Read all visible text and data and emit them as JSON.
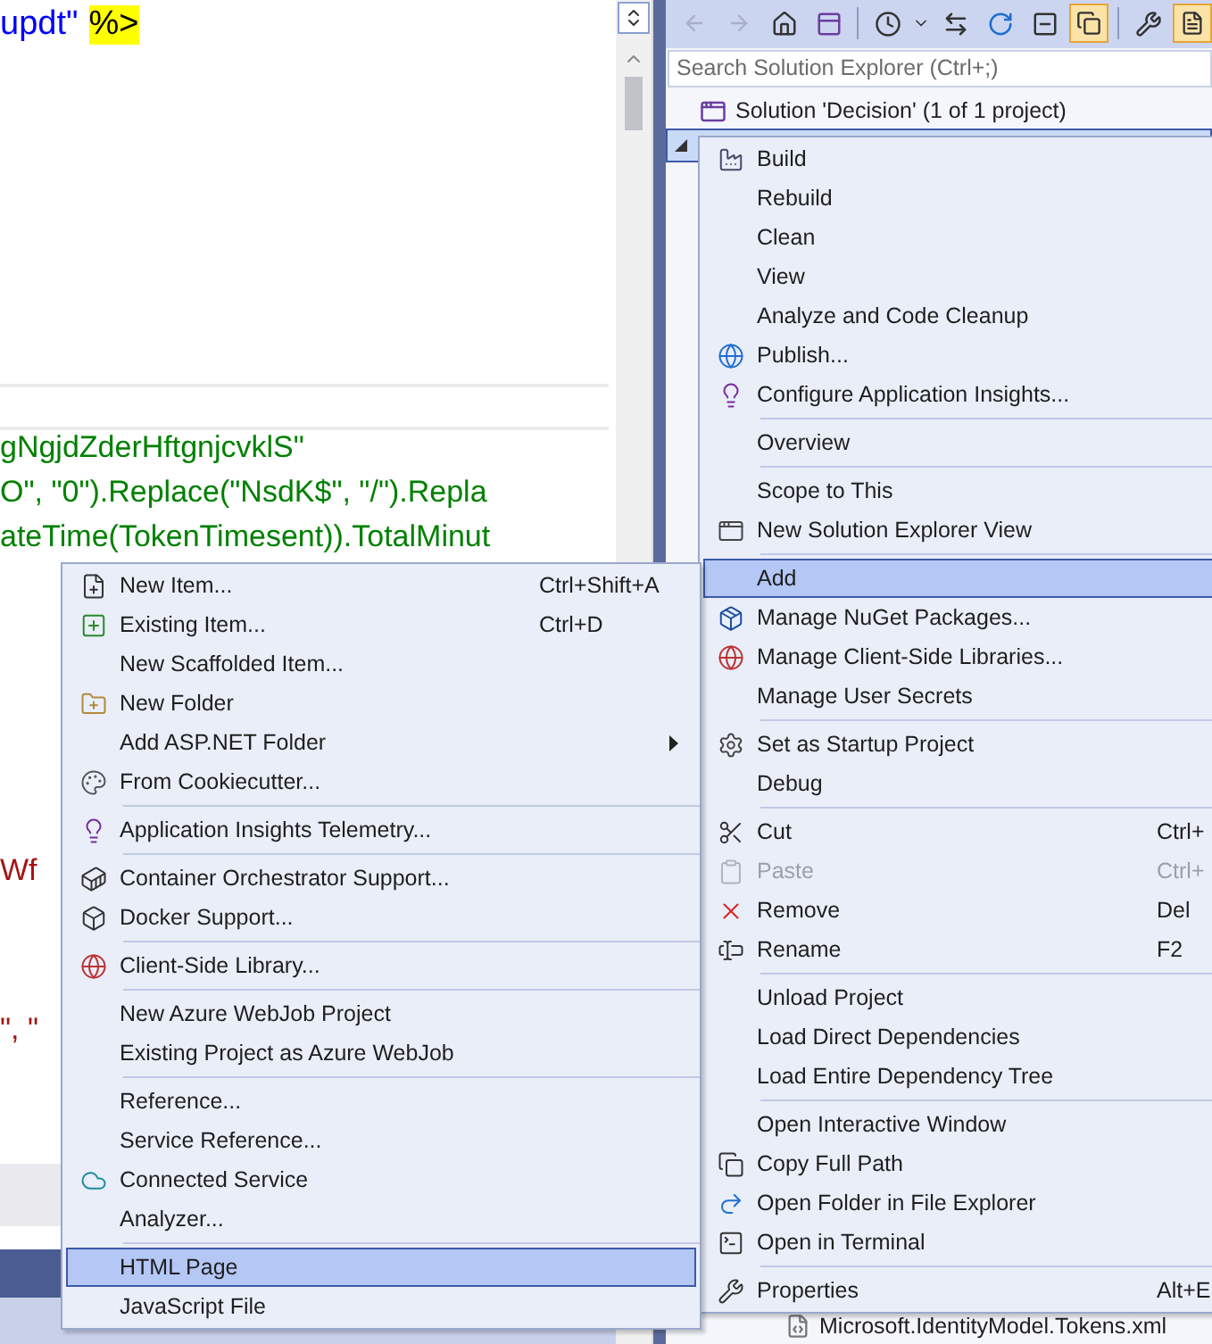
{
  "editor": {
    "top_line": [
      {
        "kind": "string",
        "text": "updt\""
      },
      {
        "kind": "delimiter",
        "text": "%>"
      }
    ],
    "code_lines": [
      {
        "kind": "string",
        "text": "gNgjdZderHftgnjcvklS\""
      },
      {
        "kind": "string",
        "text": "O\", \"0\").Replace(\"NsdK$\", \"/\").Repla"
      },
      {
        "kind": "string",
        "text": "ateTime(TokenTimesent)).TotalMinut"
      }
    ],
    "lower_lines": [
      {
        "kind": "error",
        "text": "Wf"
      },
      {
        "kind": "error",
        "text": "\", \""
      }
    ]
  },
  "solution_explorer": {
    "search": {
      "placeholder": "Search Solution Explorer (Ctrl+;)"
    },
    "tree": [
      {
        "label": "Solution 'Decision' (1 of 1 project)",
        "selected": false
      },
      {
        "selected": true,
        "expanded": true
      },
      {
        "label": "Microsoft.IdentityModel.Tokens.xml",
        "selected": false
      }
    ]
  },
  "context_menu": {
    "items": [
      {
        "kind": "item",
        "label": "Build",
        "selected": false,
        "disabled": false
      },
      {
        "kind": "item",
        "label": "Rebuild",
        "selected": false,
        "disabled": false
      },
      {
        "kind": "item",
        "label": "Clean",
        "selected": false,
        "disabled": false
      },
      {
        "kind": "item",
        "label": "View",
        "selected": false,
        "disabled": false
      },
      {
        "kind": "item",
        "label": "Analyze and Code Cleanup",
        "selected": false,
        "disabled": false
      },
      {
        "kind": "item",
        "label": "Publish...",
        "selected": false,
        "disabled": false
      },
      {
        "kind": "item",
        "label": "Configure Application Insights...",
        "selected": false,
        "disabled": false
      },
      {
        "kind": "separator"
      },
      {
        "kind": "item",
        "label": "Overview",
        "selected": false,
        "disabled": false
      },
      {
        "kind": "separator"
      },
      {
        "kind": "item",
        "label": "Scope to This",
        "selected": false,
        "disabled": false
      },
      {
        "kind": "item",
        "label": "New Solution Explorer View",
        "selected": false,
        "disabled": false
      },
      {
        "kind": "separator"
      },
      {
        "kind": "item",
        "label": "Add",
        "selected": true,
        "disabled": false
      },
      {
        "kind": "item",
        "label": "Manage NuGet Packages...",
        "selected": false,
        "disabled": false
      },
      {
        "kind": "item",
        "label": "Manage Client-Side Libraries...",
        "selected": false,
        "disabled": false
      },
      {
        "kind": "item",
        "label": "Manage User Secrets",
        "selected": false,
        "disabled": false
      },
      {
        "kind": "separator"
      },
      {
        "kind": "item",
        "label": "Set as Startup Project",
        "selected": false,
        "disabled": false
      },
      {
        "kind": "item",
        "label": "Debug",
        "selected": false,
        "disabled": false
      },
      {
        "kind": "separator"
      },
      {
        "kind": "item",
        "label": "Cut",
        "shortcut": "Ctrl+",
        "selected": false,
        "disabled": false
      },
      {
        "kind": "item",
        "label": "Paste",
        "shortcut": "Ctrl+",
        "selected": false,
        "disabled": true
      },
      {
        "kind": "item",
        "label": "Remove",
        "shortcut": "Del",
        "selected": false,
        "disabled": false
      },
      {
        "kind": "item",
        "label": "Rename",
        "shortcut": "F2",
        "selected": false,
        "disabled": false
      },
      {
        "kind": "separator"
      },
      {
        "kind": "item",
        "label": "Unload Project",
        "selected": false,
        "disabled": false
      },
      {
        "kind": "item",
        "label": "Load Direct Dependencies",
        "selected": false,
        "disabled": false
      },
      {
        "kind": "item",
        "label": "Load Entire Dependency Tree",
        "selected": false,
        "disabled": false
      },
      {
        "kind": "separator"
      },
      {
        "kind": "item",
        "label": "Open Interactive Window",
        "selected": false,
        "disabled": false
      },
      {
        "kind": "item",
        "label": "Copy Full Path",
        "selected": false,
        "disabled": false
      },
      {
        "kind": "item",
        "label": "Open Folder in File Explorer",
        "selected": false,
        "disabled": false
      },
      {
        "kind": "item",
        "label": "Open in Terminal",
        "selected": false,
        "disabled": false
      },
      {
        "kind": "separator"
      },
      {
        "kind": "item",
        "label": "Properties",
        "shortcut": "Alt+E",
        "selected": false,
        "disabled": false
      }
    ]
  },
  "add_submenu": {
    "items": [
      {
        "kind": "item",
        "label": "New Item...",
        "shortcut": "Ctrl+Shift+A",
        "selected": false
      },
      {
        "kind": "item",
        "label": "Existing Item...",
        "shortcut": "Ctrl+D",
        "selected": false
      },
      {
        "kind": "item",
        "label": "New Scaffolded Item...",
        "selected": false
      },
      {
        "kind": "item",
        "label": "New Folder",
        "selected": false
      },
      {
        "kind": "item",
        "label": "Add ASP.NET Folder",
        "submenu": true,
        "selected": false
      },
      {
        "kind": "item",
        "label": "From Cookiecutter...",
        "selected": false
      },
      {
        "kind": "separator"
      },
      {
        "kind": "item",
        "label": "Application Insights Telemetry...",
        "selected": false
      },
      {
        "kind": "separator"
      },
      {
        "kind": "item",
        "label": "Container Orchestrator Support...",
        "selected": false
      },
      {
        "kind": "item",
        "label": "Docker Support...",
        "selected": false
      },
      {
        "kind": "separator"
      },
      {
        "kind": "item",
        "label": "Client-Side Library...",
        "selected": false
      },
      {
        "kind": "separator"
      },
      {
        "kind": "item",
        "label": "New Azure WebJob Project",
        "selected": false
      },
      {
        "kind": "item",
        "label": "Existing Project as Azure WebJob",
        "selected": false
      },
      {
        "kind": "separator"
      },
      {
        "kind": "item",
        "label": "Reference...",
        "selected": false
      },
      {
        "kind": "item",
        "label": "Service Reference...",
        "selected": false
      },
      {
        "kind": "item",
        "label": "Connected Service",
        "selected": false
      },
      {
        "kind": "item",
        "label": "Analyzer...",
        "selected": false
      },
      {
        "kind": "separator"
      },
      {
        "kind": "item",
        "label": "HTML Page",
        "selected": true
      },
      {
        "kind": "item",
        "label": "JavaScript File",
        "selected": false
      }
    ]
  }
}
